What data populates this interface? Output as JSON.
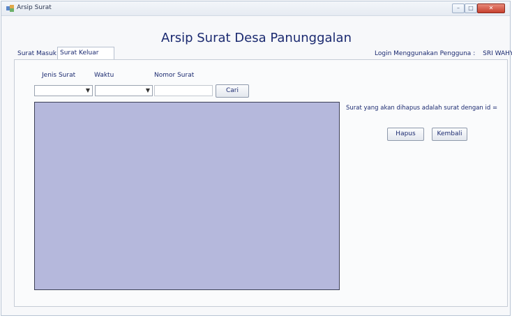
{
  "window": {
    "title": "Arsip Surat",
    "controls": {
      "minimize": "–",
      "maximize": "□",
      "close": "✕"
    }
  },
  "heading": "Arsip Surat Desa Panunggalan",
  "tabs": [
    {
      "label": "Surat Masuk",
      "active": false
    },
    {
      "label": "Surat Keluar",
      "active": true
    }
  ],
  "login": {
    "label": "Login Menggunakan Pengguna :",
    "user": "SRI WAHYUNI"
  },
  "filters": {
    "jenis_label": "Jenis Surat",
    "waktu_label": "Waktu",
    "nomor_label": "Nomor Surat",
    "jenis_value": "",
    "waktu_value": "",
    "nomor_value": "",
    "search_button": "Cari"
  },
  "delete_panel": {
    "message": "Surat yang akan dihapus adalah surat dengan id =",
    "delete_button": "Hapus",
    "back_button": "Kembali"
  },
  "colors": {
    "grid_background": "#b5b8dc",
    "text": "#1b2a70"
  }
}
